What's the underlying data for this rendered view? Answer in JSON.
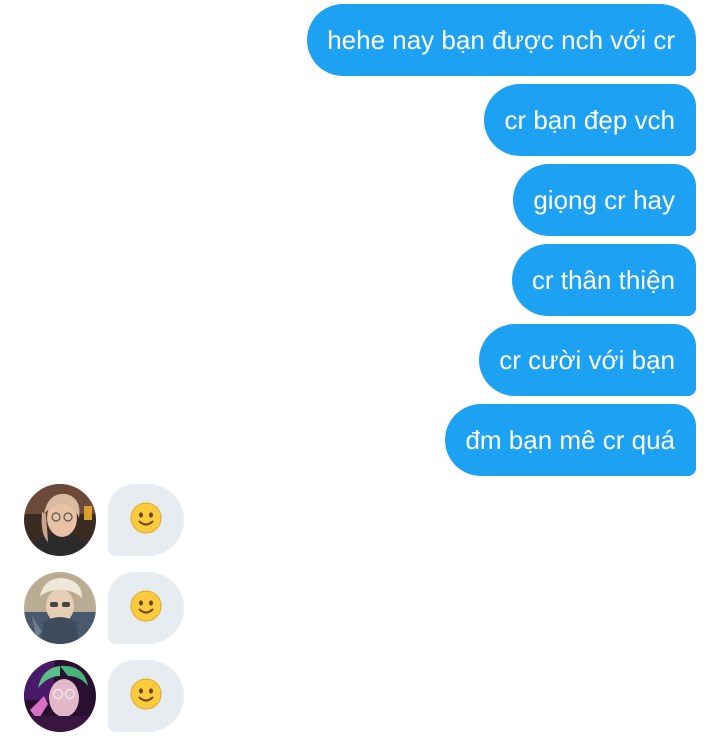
{
  "conversation": {
    "sent_messages": [
      {
        "text": "hehe nay bạn được nch với cr"
      },
      {
        "text": "cr bạn đẹp vch"
      },
      {
        "text": "giọng cr hay"
      },
      {
        "text": "cr thân thiện"
      },
      {
        "text": "cr cười với bạn"
      },
      {
        "text": "đm bạn mê cr quá"
      }
    ],
    "reactions": [
      {
        "emoji": "slightly-smiling-face"
      },
      {
        "emoji": "slightly-smiling-face"
      },
      {
        "emoji": "slightly-smiling-face"
      }
    ]
  },
  "colors": {
    "sent_bubble": "#1da1f2",
    "sent_text": "#ffffff",
    "received_bubble": "#e6ecf0",
    "emoji_face": "#fbcb3d"
  }
}
